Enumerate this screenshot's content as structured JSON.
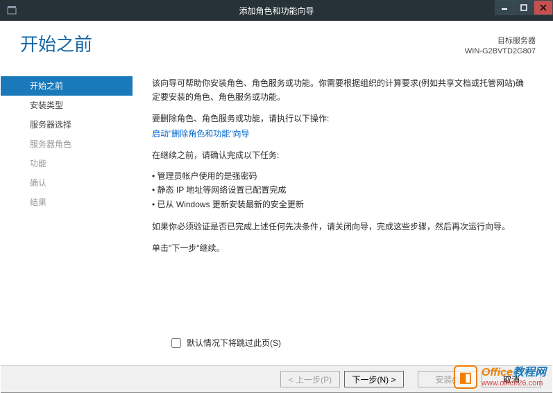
{
  "titlebar": {
    "title": "添加角色和功能向导"
  },
  "header": {
    "page_title": "开始之前",
    "target_label": "目标服务器",
    "target_value": "WIN-G2BVTD2G807"
  },
  "sidebar": {
    "items": [
      {
        "label": "开始之前",
        "state": "active"
      },
      {
        "label": "安装类型",
        "state": "enabled"
      },
      {
        "label": "服务器选择",
        "state": "enabled"
      },
      {
        "label": "服务器角色",
        "state": "disabled"
      },
      {
        "label": "功能",
        "state": "disabled"
      },
      {
        "label": "确认",
        "state": "disabled"
      },
      {
        "label": "结果",
        "state": "disabled"
      }
    ]
  },
  "main": {
    "intro": "该向导可帮助你安装角色、角色服务或功能。你需要根据组织的计算要求(例如共享文档或托管网站)确定要安装的角色、角色服务或功能。",
    "remove_label": "要删除角色、角色服务或功能，请执行以下操作:",
    "remove_link": "启动\"删除角色和功能\"向导",
    "before_continue": "在继续之前，请确认完成以下任务:",
    "bullets": [
      "管理员帐户使用的是强密码",
      "静态 IP 地址等网络设置已配置完成",
      "已从 Windows 更新安装最新的安全更新"
    ],
    "verify_note": "如果你必须验证是否已完成上述任何先决条件，请关闭向导，完成这些步骤，然后再次运行向导。",
    "click_next": "单击\"下一步\"继续。",
    "skip_label": "默认情况下将跳过此页(S)"
  },
  "footer": {
    "prev": "< 上一步(P)",
    "next": "下一步(N) >",
    "install": "安装(I)",
    "cancel": "取消"
  },
  "watermark": {
    "brand_a": "Office",
    "brand_b": "教程网",
    "url": "www.office26.com"
  }
}
